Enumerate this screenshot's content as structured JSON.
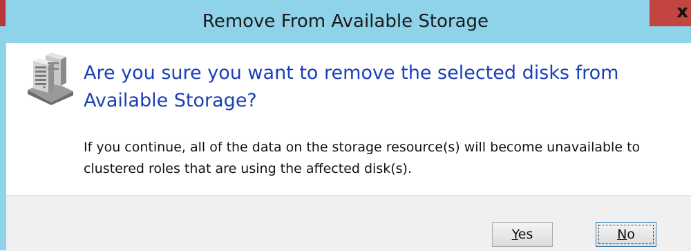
{
  "dialog": {
    "title": "Remove From Available Storage",
    "close_glyph": "x",
    "icon": "server-storage-icon",
    "heading": "Are you sure you want to remove the selected disks from Available Storage?",
    "message": "If you continue, all of the data on the storage resource(s) will become unavailable to clustered roles that are using the affected disk(s)."
  },
  "buttons": {
    "yes": {
      "mnemonic": "Y",
      "rest": "es"
    },
    "no": {
      "mnemonic": "N",
      "rest": "o"
    }
  },
  "colors": {
    "titlebar": "#8fd3ea",
    "close": "#c2453f",
    "heading": "#1a3fb8",
    "footer": "#f0f0f0"
  }
}
